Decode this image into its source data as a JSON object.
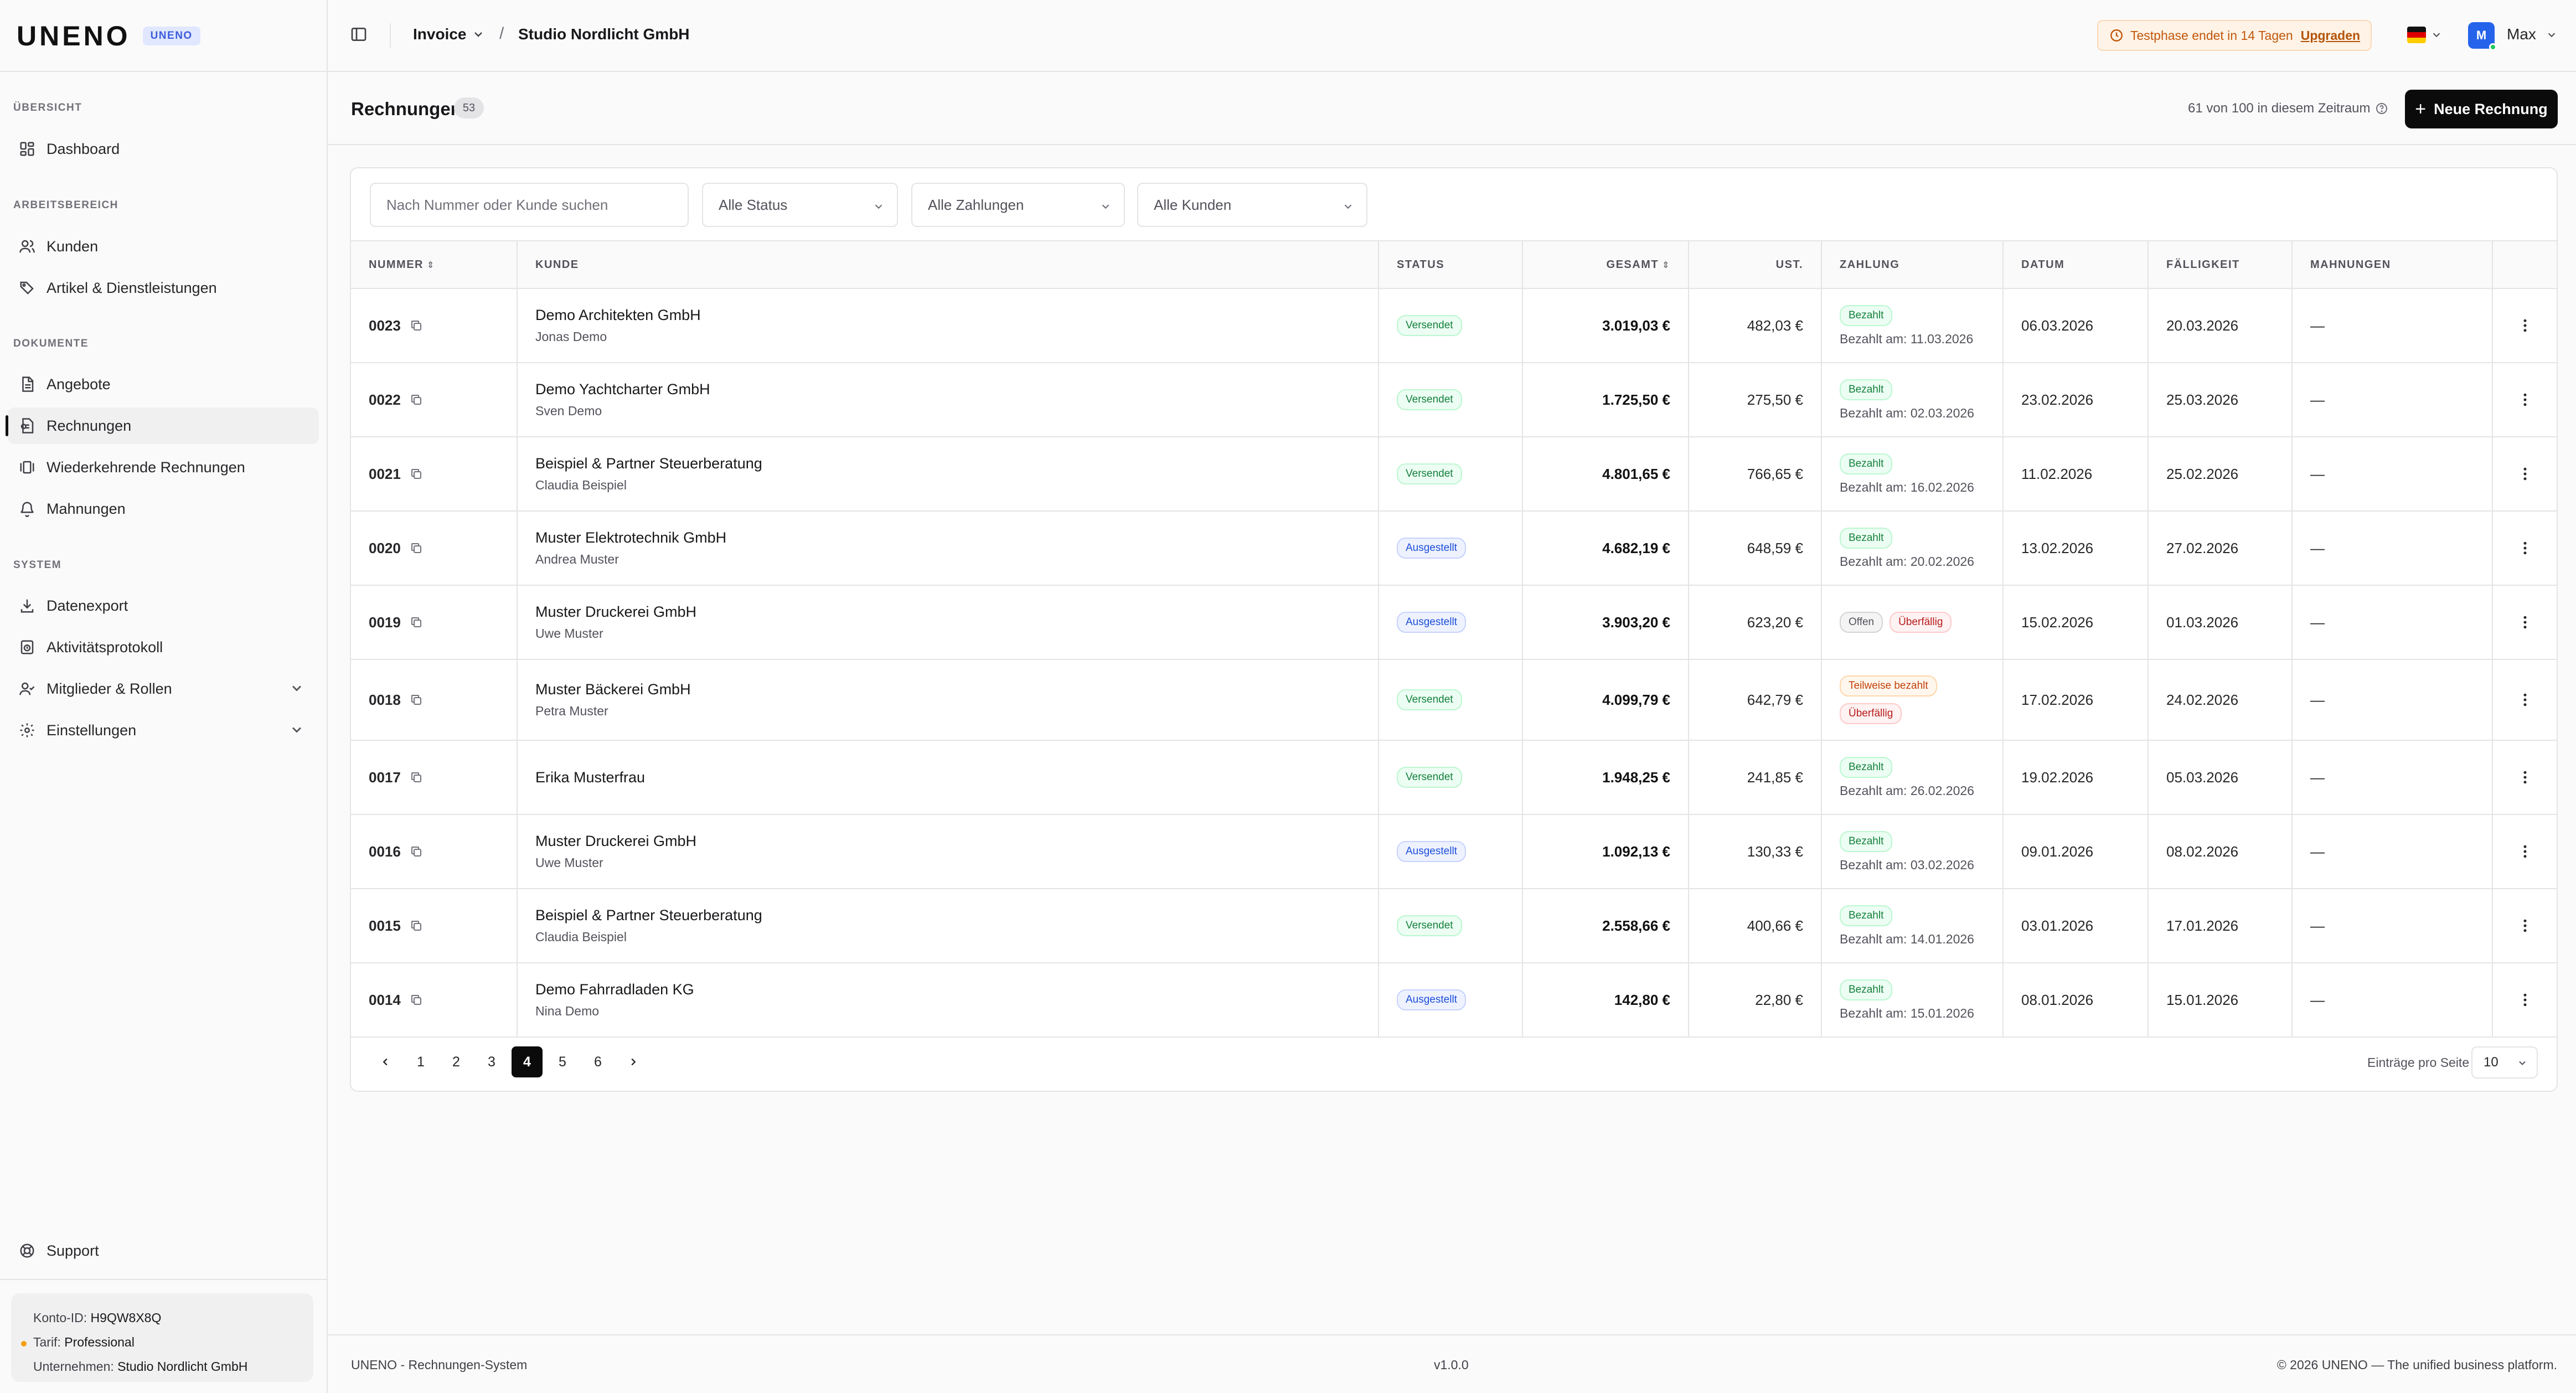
{
  "brand": {
    "logo": "UNENO",
    "badge": "UNENO"
  },
  "sidebar": {
    "sections": [
      {
        "title": "ÜBERSICHT"
      },
      {
        "title": "ARBEITSBEREICH"
      },
      {
        "title": "DOKUMENTE"
      },
      {
        "title": "SYSTEM"
      }
    ],
    "items": [
      {
        "label": "Dashboard",
        "icon": "grid-icon"
      },
      {
        "label": "Kunden",
        "icon": "users-icon"
      },
      {
        "label": "Artikel & Dienstleistungen",
        "icon": "tags-icon"
      },
      {
        "label": "Angebote",
        "icon": "document-icon"
      },
      {
        "label": "Rechnungen",
        "icon": "receipt-icon",
        "active": true
      },
      {
        "label": "Wiederkehrende Rechnungen",
        "icon": "recurring-icon"
      },
      {
        "label": "Mahnungen",
        "icon": "bell-icon"
      },
      {
        "label": "Datenexport",
        "icon": "download-icon"
      },
      {
        "label": "Aktivitätsprotokoll",
        "icon": "clock-icon"
      },
      {
        "label": "Mitglieder & Rollen",
        "icon": "users-icon"
      },
      {
        "label": "Einstellungen",
        "icon": "gear-icon"
      }
    ],
    "support": "Support",
    "account": {
      "id_label": "Konto-ID:",
      "id_value": "H9QW8X8Q",
      "plan_label": "Tarif:",
      "plan_value": "Professional",
      "company_label": "Unternehmen:",
      "company_value": "Studio Nordlicht GmbH"
    }
  },
  "header": {
    "breadcrumb_app": "Invoice",
    "breadcrumb_slash": "/",
    "breadcrumb_company": "Studio Nordlicht GmbH",
    "trial_text": "Testphase endet in 14 Tagen",
    "upgrade_label": "Upgraden",
    "user_initial": "M",
    "user_name": "Max",
    "colors": {
      "accent": "#2563eb",
      "trial": "#c2570c"
    }
  },
  "page": {
    "title": "Rechnungen",
    "count": "53",
    "quota": "61 von 100 in diesem Zeitraum",
    "new_button": "Neue Rechnung"
  },
  "filters": {
    "search_placeholder": "Nach Nummer oder Kunde suchen",
    "status": "Alle Status",
    "payments": "Alle Zahlungen",
    "customers": "Alle Kunden"
  },
  "table": {
    "columns": [
      "NUMMER",
      "KUNDE",
      "STATUS",
      "GESAMT",
      "UST.",
      "ZAHLUNG",
      "DATUM",
      "FÄLLIGKEIT",
      "MAHNUNGEN"
    ],
    "rows": [
      {
        "number": "0023",
        "customer": "Demo Architekten GmbH",
        "contact": "Jonas Demo",
        "status": "Versendet",
        "total": "3.019,03 €",
        "vat": "482,03 €",
        "pay1": "Bezahlt",
        "pay2": "",
        "paid_on": "Bezahlt am: 11.03.2026",
        "date": "06.03.2026",
        "due": "20.03.2026",
        "dunning": "—"
      },
      {
        "number": "0022",
        "customer": "Demo Yachtcharter GmbH",
        "contact": "Sven Demo",
        "status": "Versendet",
        "total": "1.725,50 €",
        "vat": "275,50 €",
        "pay1": "Bezahlt",
        "pay2": "",
        "paid_on": "Bezahlt am: 02.03.2026",
        "date": "23.02.2026",
        "due": "25.03.2026",
        "dunning": "—"
      },
      {
        "number": "0021",
        "customer": "Beispiel & Partner Steuerberatung",
        "contact": "Claudia Beispiel",
        "status": "Versendet",
        "total": "4.801,65 €",
        "vat": "766,65 €",
        "pay1": "Bezahlt",
        "pay2": "",
        "paid_on": "Bezahlt am: 16.02.2026",
        "date": "11.02.2026",
        "due": "25.02.2026",
        "dunning": "—"
      },
      {
        "number": "0020",
        "customer": "Muster Elektrotechnik GmbH",
        "contact": "Andrea Muster",
        "status": "Ausgestellt",
        "total": "4.682,19 €",
        "vat": "648,59 €",
        "pay1": "Bezahlt",
        "pay2": "",
        "paid_on": "Bezahlt am: 20.02.2026",
        "date": "13.02.2026",
        "due": "27.02.2026",
        "dunning": "—"
      },
      {
        "number": "0019",
        "customer": "Muster Druckerei GmbH",
        "contact": "Uwe Muster",
        "status": "Ausgestellt",
        "total": "3.903,20 €",
        "vat": "623,20 €",
        "pay1": "Offen",
        "pay2": "Überfällig",
        "paid_on": "",
        "date": "15.02.2026",
        "due": "01.03.2026",
        "dunning": "—"
      },
      {
        "number": "0018",
        "customer": "Muster Bäckerei GmbH",
        "contact": "Petra Muster",
        "status": "Versendet",
        "total": "4.099,79 €",
        "vat": "642,79 €",
        "pay1": "Teilweise bezahlt",
        "pay2": "Überfällig",
        "paid_on": "",
        "date": "17.02.2026",
        "due": "24.02.2026",
        "dunning": "—"
      },
      {
        "number": "0017",
        "customer": "Erika Musterfrau",
        "contact": "",
        "status": "Versendet",
        "total": "1.948,25 €",
        "vat": "241,85 €",
        "pay1": "Bezahlt",
        "pay2": "",
        "paid_on": "Bezahlt am: 26.02.2026",
        "date": "19.02.2026",
        "due": "05.03.2026",
        "dunning": "—"
      },
      {
        "number": "0016",
        "customer": "Muster Druckerei GmbH",
        "contact": "Uwe Muster",
        "status": "Ausgestellt",
        "total": "1.092,13 €",
        "vat": "130,33 €",
        "pay1": "Bezahlt",
        "pay2": "",
        "paid_on": "Bezahlt am: 03.02.2026",
        "date": "09.01.2026",
        "due": "08.02.2026",
        "dunning": "—"
      },
      {
        "number": "0015",
        "customer": "Beispiel & Partner Steuerberatung",
        "contact": "Claudia Beispiel",
        "status": "Versendet",
        "total": "2.558,66 €",
        "vat": "400,66 €",
        "pay1": "Bezahlt",
        "pay2": "",
        "paid_on": "Bezahlt am: 14.01.2026",
        "date": "03.01.2026",
        "due": "17.01.2026",
        "dunning": "—"
      },
      {
        "number": "0014",
        "customer": "Demo Fahrradladen KG",
        "contact": "Nina Demo",
        "status": "Ausgestellt",
        "total": "142,80 €",
        "vat": "22,80 €",
        "pay1": "Bezahlt",
        "pay2": "",
        "paid_on": "Bezahlt am: 15.01.2026",
        "date": "08.01.2026",
        "due": "15.01.2026",
        "dunning": "—"
      }
    ]
  },
  "pagination": {
    "pages": [
      "1",
      "2",
      "3",
      "4",
      "5",
      "6"
    ],
    "current": "4",
    "per_page_label": "Einträge pro Seite",
    "per_page": "10"
  },
  "footer": {
    "left": "UNENO - Rechnungen-System",
    "center": "v1.0.0",
    "right": "© 2026 UNENO — The unified business platform."
  }
}
